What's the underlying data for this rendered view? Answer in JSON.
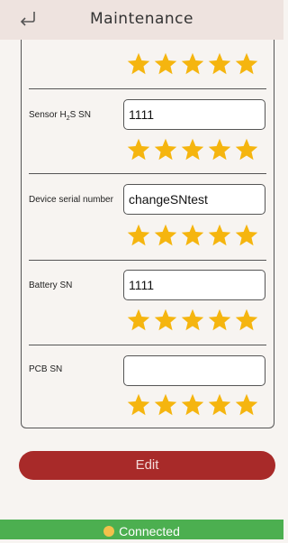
{
  "header": {
    "title": "Maintenance",
    "back_icon": "back-arrow-icon"
  },
  "fields": [
    {
      "label": "Sensor H",
      "label_sub": "2",
      "label_tail": "S SN",
      "value": "1111",
      "rating": 5
    },
    {
      "label": "Device serial number",
      "value": "changeSNtest",
      "rating": 5
    },
    {
      "label": "Battery SN",
      "value": "1111",
      "rating": 5
    },
    {
      "label": "PCB SN",
      "value": "",
      "rating": 5
    }
  ],
  "top_rating": 5,
  "edit_button": {
    "label": "Edit"
  },
  "status": {
    "text": "Connected",
    "icon": "smiley-icon"
  },
  "colors": {
    "accent": "#a82a29",
    "star": "#f5b50f",
    "status": "#4caf50",
    "header": "#eee3df"
  }
}
